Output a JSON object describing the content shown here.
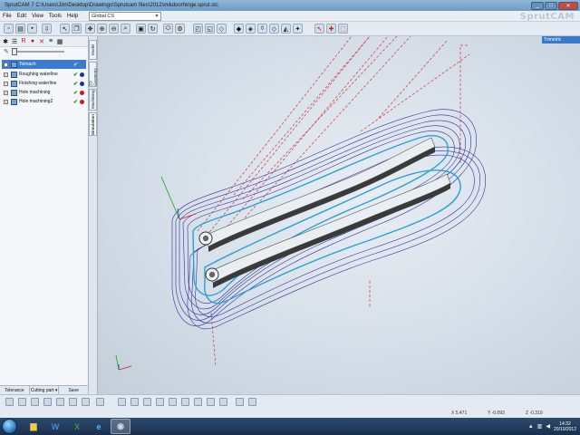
{
  "window": {
    "title": "SprutCAM 7  C:\\Users\\Jim\\Desktop\\Drawings\\Sprutcam files\\2012\\mikdoorhinge.sprut.stc",
    "minimize": "_",
    "maximize": "□",
    "close": "✕"
  },
  "menu": [
    "File",
    "Edit",
    "View",
    "Tools",
    "Help"
  ],
  "coordinate_system": {
    "value": "Global CS"
  },
  "brand": "SprutCAM",
  "left_pane": {
    "tree": [
      {
        "label": "Toimach",
        "type": "root"
      },
      {
        "label": "Roughing waterline",
        "dot_color": "#1b2f9a"
      },
      {
        "label": "Finishing waterline",
        "dot_color": "#1b2f9a"
      },
      {
        "label": "Hole machining",
        "dot_color": "#c01f1f"
      },
      {
        "label": "Hole machining2",
        "dot_color": "#c01f1f"
      }
    ],
    "bottom_buttons": [
      "Tolerance",
      "Cutting part ▾",
      "Save"
    ]
  },
  "vertical_tabs": [
    "Model",
    "2D Geometry",
    "Machining",
    "Simulation"
  ],
  "view_dropdown": "Trimetric",
  "status": {
    "x": "X 5.471",
    "y": "Y -0.093",
    "z": "Z -0.319"
  },
  "taskbar": {
    "clock_time": "14:32",
    "clock_date": "20/10/2012"
  },
  "colors": {
    "selection": "#3c7cd0",
    "toolpath_blue": "#2e2f9c",
    "toolpath_cyan": "#2ba0d8",
    "rapid_red": "#d0363a"
  },
  "icons": [
    "save-icon",
    "open-icon",
    "zoom-icon",
    "rotate-icon",
    "settings-icon"
  ]
}
